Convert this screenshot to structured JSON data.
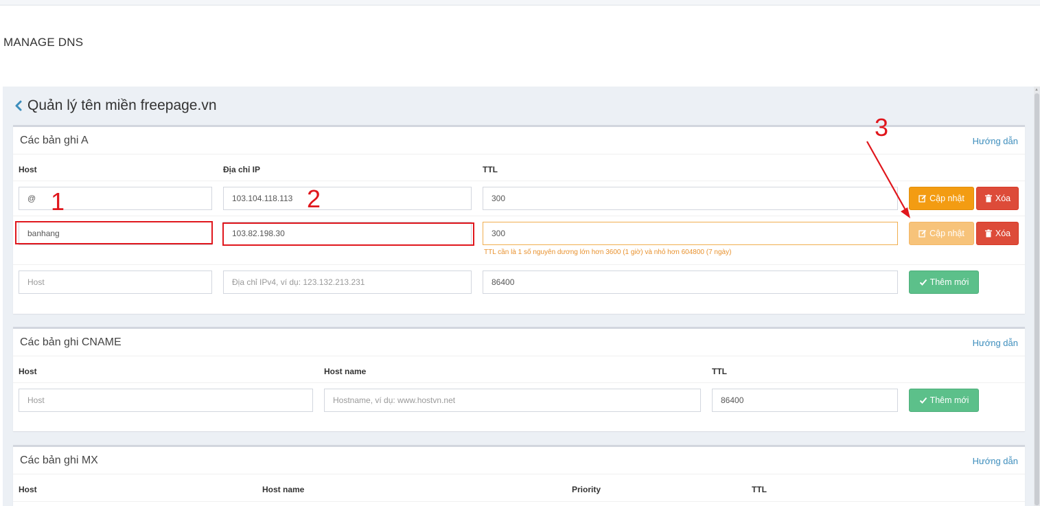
{
  "app": {
    "title": "MANAGE DNS"
  },
  "page": {
    "heading": "Quản lý tên miền freepage.vn"
  },
  "a_records": {
    "title": "Các bản ghi A",
    "guide": "Hướng dẫn",
    "columns": {
      "host": "Host",
      "ip": "Địa chỉ IP",
      "ttl": "TTL"
    },
    "rows": [
      {
        "host": "@",
        "ip": "103.104.118.113",
        "ttl": "300",
        "update": "Cập nhật",
        "delete": "Xóa"
      },
      {
        "host": "banhang",
        "ip": "103.82.198.30",
        "ttl": "300",
        "update": "Cập nhật",
        "delete": "Xóa",
        "error": "TTL cần là 1 số nguyên dương lớn hơn 3600 (1 giờ) và nhỏ hơn 604800 (7 ngày)"
      }
    ],
    "new_row": {
      "host_placeholder": "Host",
      "ip_placeholder": "Địa chỉ IPv4, ví dụ: 123.132.213.231",
      "ttl": "86400",
      "add": "Thêm mới"
    }
  },
  "cname_records": {
    "title": "Các bản ghi CNAME",
    "guide": "Hướng dẫn",
    "columns": {
      "host": "Host",
      "hostname": "Host name",
      "ttl": "TTL"
    },
    "new_row": {
      "host_placeholder": "Host",
      "hostname_placeholder": "Hostname, ví dụ: www.hostvn.net",
      "ttl": "86400",
      "add": "Thêm mới"
    }
  },
  "mx_records": {
    "title": "Các bản ghi MX",
    "guide": "Hướng dẫn",
    "columns": {
      "host": "Host",
      "hostname": "Host name",
      "priority": "Priority",
      "ttl": "TTL"
    }
  },
  "annotations": {
    "one": "1",
    "two": "2",
    "three": "3",
    "color": "#e0161c"
  },
  "colors": {
    "update": "#f39c12",
    "delete": "#dd4b39",
    "add": "#5cc08a",
    "link": "#3c8dbc",
    "warning": "#e8912d"
  }
}
